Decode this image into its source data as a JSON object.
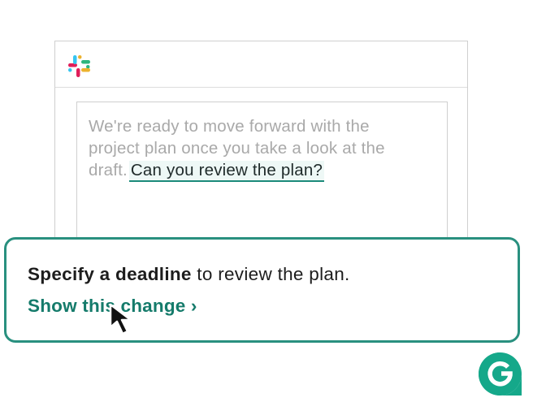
{
  "message": {
    "lines": [
      "We're ready to move forward with the",
      "project plan once you take a look at the",
      "draft."
    ],
    "highlighted": "Can you review the plan?"
  },
  "suggestion": {
    "bold": "Specify a deadline",
    "rest": " to review the plan.",
    "action": "Show this change ›"
  },
  "icons": {
    "app": "slack-logo-icon",
    "assistant": "grammarly-logo-icon",
    "pointer": "mouse-cursor-icon"
  },
  "colors": {
    "accent": "#157b6b",
    "border_accent": "#29907f",
    "logo": "#15c39a"
  }
}
